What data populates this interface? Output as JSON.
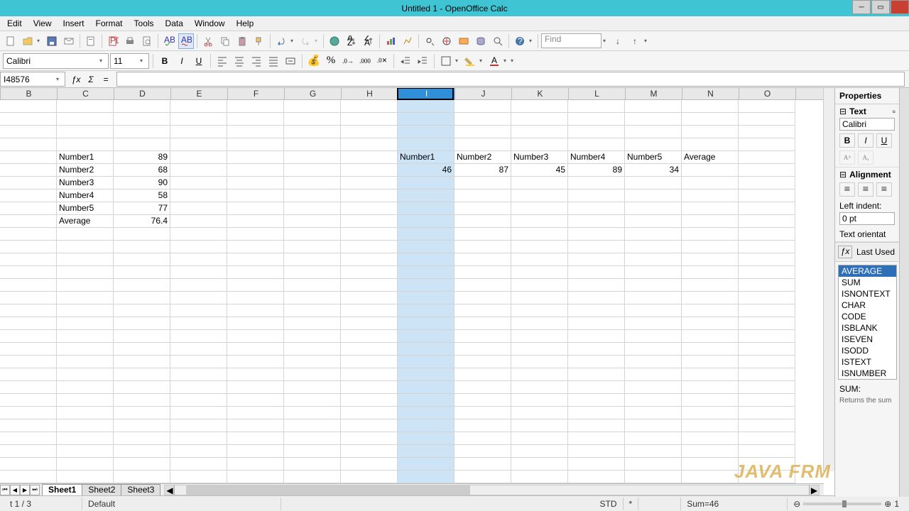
{
  "title": "Untitled 1 - OpenOffice Calc",
  "menu": [
    "Edit",
    "View",
    "Insert",
    "Format",
    "Tools",
    "Data",
    "Window",
    "Help"
  ],
  "find_placeholder": "Find",
  "font": {
    "name": "Calibri",
    "size": "11"
  },
  "namebox": "I48576",
  "cols": [
    "B",
    "C",
    "D",
    "E",
    "F",
    "G",
    "H",
    "I",
    "J",
    "K",
    "L",
    "M",
    "N",
    "O"
  ],
  "selected_col": "I",
  "v_labels": [
    "Number1",
    "Number2",
    "Number3",
    "Number4",
    "Number5",
    "Average"
  ],
  "v_values": [
    "89",
    "68",
    "90",
    "58",
    "77",
    "76.4"
  ],
  "h_labels": [
    "Number1",
    "Number2",
    "Number3",
    "Number4",
    "Number5",
    "Average"
  ],
  "h_values": [
    "46",
    "87",
    "45",
    "89",
    "34"
  ],
  "tabs": [
    "Sheet1",
    "Sheet2",
    "Sheet3"
  ],
  "status": {
    "sheet": "t 1 / 3",
    "style": "Default",
    "mode": "STD",
    "mod": "*",
    "sum": "Sum=46"
  },
  "sidebar": {
    "title": "Properties",
    "text_label": "Text",
    "font": "Calibri",
    "align_label": "Alignment",
    "indent_label": "Left indent:",
    "indent_val": "0 pt",
    "orient": "Text orientat",
    "lastused": "Last Used",
    "funcs": [
      "AVERAGE",
      "SUM",
      "ISNONTEXT",
      "CHAR",
      "CODE",
      "ISBLANK",
      "ISEVEN",
      "ISODD",
      "ISTEXT",
      "ISNUMBER"
    ],
    "sumlbl": "SUM:",
    "desc": "Returns the sum"
  },
  "watermark": "JAVA FRM"
}
